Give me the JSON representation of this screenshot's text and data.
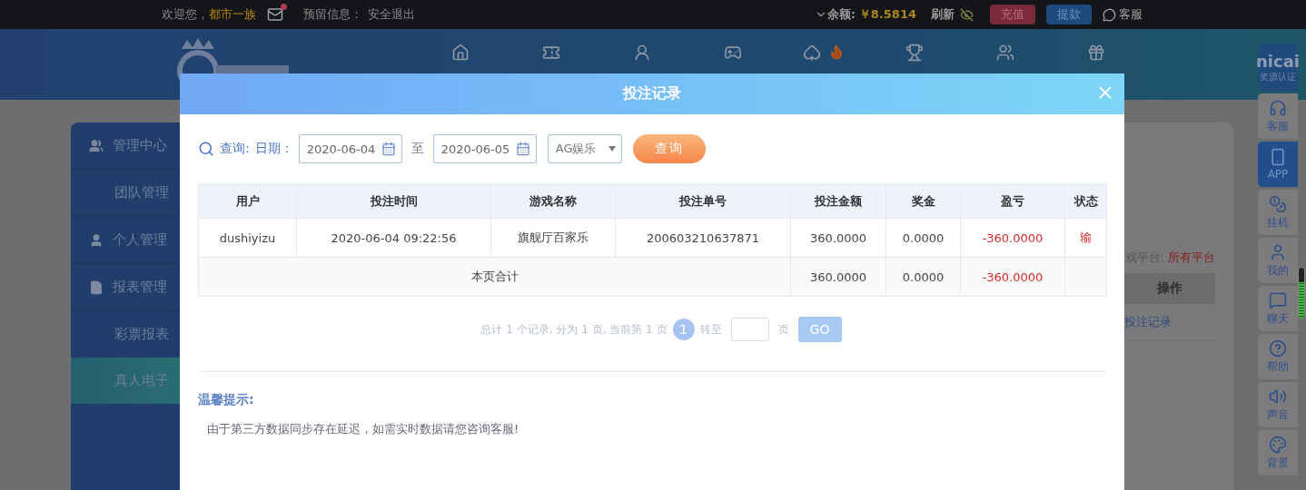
{
  "top_bar": {
    "welcome": "欢迎您，",
    "username": "都市一族",
    "mail_unread": true,
    "reserved_label": "预留信息：",
    "logout": "安全退出",
    "balance_label": "余额:",
    "balance": "￥8.5814",
    "refresh": "刷新",
    "deposit": "充值",
    "withdraw": "提款",
    "service": "客服"
  },
  "sidebar": {
    "items": [
      {
        "label": "管理中心",
        "kind": "group",
        "selected": false
      },
      {
        "label": "团队管理",
        "kind": "item",
        "selected": false
      },
      {
        "label": "个人管理",
        "kind": "group",
        "selected": false
      },
      {
        "label": "报表管理",
        "kind": "group",
        "selected": false
      },
      {
        "label": "彩票报表",
        "kind": "item",
        "selected": false
      },
      {
        "label": "真人电子",
        "kind": "item",
        "selected": true
      }
    ]
  },
  "background_card": {
    "platform_label": "戏平台:",
    "platform_value": "所有平台",
    "column": "操作",
    "cell": "投注记录"
  },
  "float_toolbar": {
    "badge_title": "nicai",
    "badge_subtitle": "奖源认证",
    "items": [
      {
        "label": "客服",
        "selected": false
      },
      {
        "label": "APP",
        "selected": true
      },
      {
        "label": "挂机",
        "selected": false
      },
      {
        "label": "我的",
        "selected": false
      },
      {
        "label": "聊天",
        "selected": false
      },
      {
        "label": "帮助",
        "selected": false
      },
      {
        "label": "声音",
        "selected": false
      },
      {
        "label": "背景",
        "selected": false
      }
    ],
    "volume": {
      "level": 0.72
    }
  },
  "modal": {
    "title": "投注记录",
    "query": {
      "label": "查询:",
      "date_label": "日期：",
      "from": "2020-06-04",
      "separator": "至",
      "to": "2020-06-05",
      "platform": "AG娱乐",
      "button": "查询"
    },
    "table": {
      "columns": [
        {
          "label": "用户",
          "accent": false
        },
        {
          "label": "投注时间",
          "accent": false
        },
        {
          "label": "游戏名称",
          "accent": false
        },
        {
          "label": "投注单号",
          "accent": false
        },
        {
          "label": "投注金额",
          "accent": false
        },
        {
          "label": "奖金",
          "accent": false
        },
        {
          "label": "盈亏",
          "accent": true
        },
        {
          "label": "状态",
          "accent": true
        }
      ],
      "rows": [
        [
          "dushiyizu",
          "2020-06-04 09:22:56",
          "旗舰厅百家乐",
          "200603210637871",
          "360.0000",
          "0.0000",
          "-360.0000",
          "输"
        ]
      ],
      "summary": {
        "label": "本页合计",
        "cells": [
          "360.0000",
          "0.0000",
          "-360.0000"
        ]
      }
    },
    "pagination": {
      "summary": "总计 1 个记录, 分为 1 页, 当前第 1 页",
      "current": "1",
      "goto_label": "转至",
      "page_suffix": "页",
      "go": "GO"
    },
    "notice": {
      "title": "温馨提示:",
      "text": "由于第三方数据同步存在延迟，如需实时数据请您咨询客服!"
    }
  }
}
